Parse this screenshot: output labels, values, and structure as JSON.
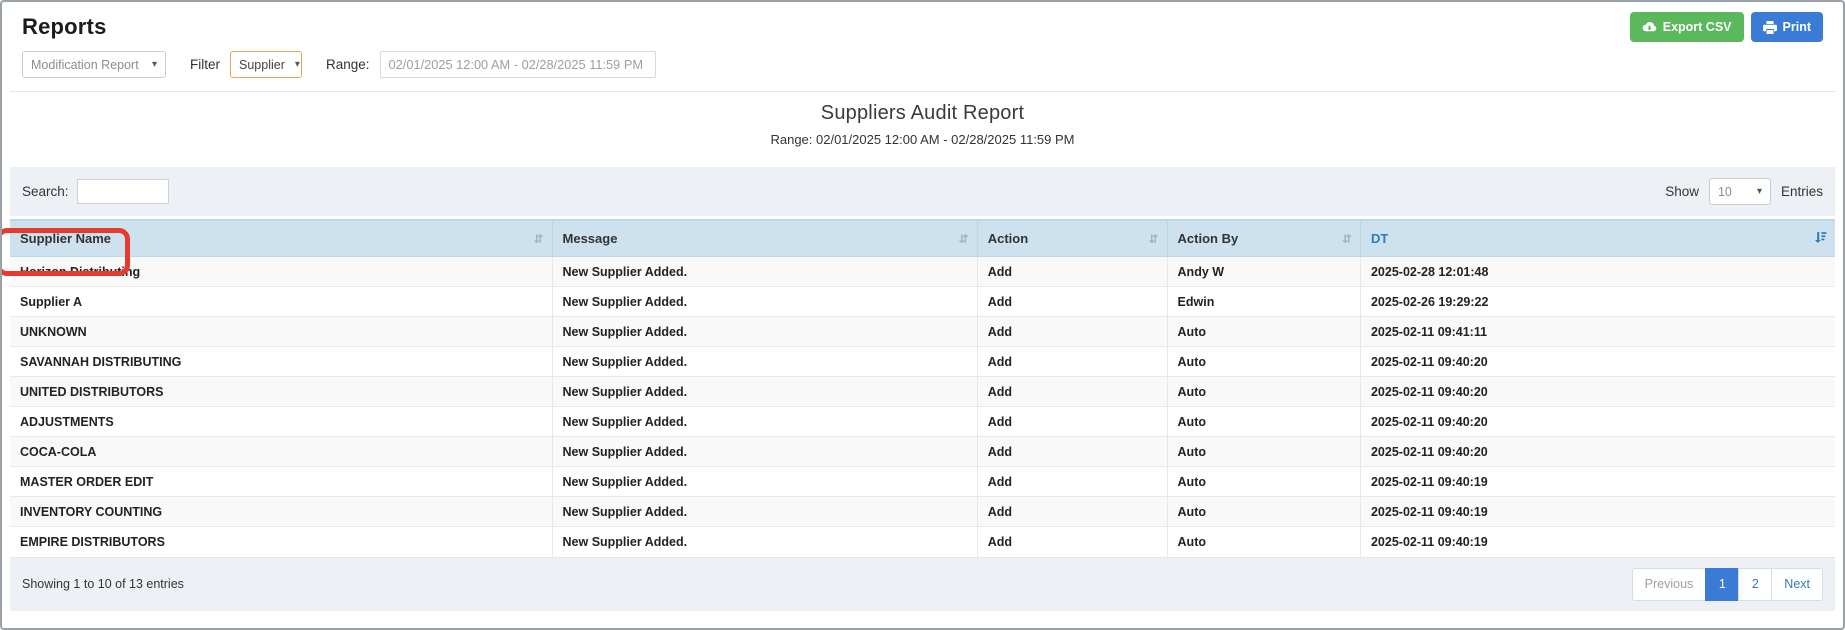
{
  "page": {
    "title": "Reports"
  },
  "controls": {
    "report_type_select": {
      "value": "Modification Report"
    },
    "filter_label": "Filter",
    "filter_select": {
      "value": "Supplier"
    },
    "range_label": "Range:",
    "range_value": "02/01/2025 12:00 AM - 02/28/2025 11:59 PM",
    "export_csv_label": "Export CSV",
    "print_label": "Print"
  },
  "report": {
    "title": "Suppliers Audit Report",
    "subtitle": "Range: 02/01/2025 12:00 AM - 02/28/2025 11:59 PM"
  },
  "table_controls": {
    "search_label": "Search:",
    "search_value": "",
    "show_label": "Show",
    "page_size": "10",
    "entries_label": "Entries"
  },
  "table": {
    "columns": [
      {
        "label": "Supplier Name",
        "sort": "inactive"
      },
      {
        "label": "Message",
        "sort": "inactive"
      },
      {
        "label": "Action",
        "sort": "inactive"
      },
      {
        "label": "Action By",
        "sort": "inactive"
      },
      {
        "label": "DT",
        "sort": "desc-active"
      }
    ],
    "rows": [
      {
        "supplier": "Horizon Distributing",
        "message": "New Supplier Added.",
        "action": "Add",
        "action_by": "Andy W",
        "dt": "2025-02-28 12:01:48"
      },
      {
        "supplier": "Supplier A",
        "message": "New Supplier Added.",
        "action": "Add",
        "action_by": "Edwin",
        "dt": "2025-02-26 19:29:22"
      },
      {
        "supplier": "UNKNOWN",
        "message": "New Supplier Added.",
        "action": "Add",
        "action_by": "Auto",
        "dt": "2025-02-11 09:41:11"
      },
      {
        "supplier": "SAVANNAH DISTRIBUTING",
        "message": "New Supplier Added.",
        "action": "Add",
        "action_by": "Auto",
        "dt": "2025-02-11 09:40:20"
      },
      {
        "supplier": "UNITED DISTRIBUTORS",
        "message": "New Supplier Added.",
        "action": "Add",
        "action_by": "Auto",
        "dt": "2025-02-11 09:40:20"
      },
      {
        "supplier": "ADJUSTMENTS",
        "message": "New Supplier Added.",
        "action": "Add",
        "action_by": "Auto",
        "dt": "2025-02-11 09:40:20"
      },
      {
        "supplier": "COCA-COLA",
        "message": "New Supplier Added.",
        "action": "Add",
        "action_by": "Auto",
        "dt": "2025-02-11 09:40:20"
      },
      {
        "supplier": "MASTER ORDER EDIT",
        "message": "New Supplier Added.",
        "action": "Add",
        "action_by": "Auto",
        "dt": "2025-02-11 09:40:19"
      },
      {
        "supplier": "INVENTORY COUNTING",
        "message": "New Supplier Added.",
        "action": "Add",
        "action_by": "Auto",
        "dt": "2025-02-11 09:40:19"
      },
      {
        "supplier": "EMPIRE DISTRIBUTORS",
        "message": "New Supplier Added.",
        "action": "Add",
        "action_by": "Auto",
        "dt": "2025-02-11 09:40:19"
      }
    ]
  },
  "footer": {
    "summary": "Showing 1 to 10 of 13 entries",
    "pagination": {
      "previous": "Previous",
      "pages": [
        "1",
        "2"
      ],
      "active_page": "1",
      "next": "Next"
    }
  },
  "annotation": {
    "highlight_target": "supplier-name-header",
    "color": "#e8392f"
  },
  "colors": {
    "header_bg": "#cde2ee",
    "toolbar_bg": "#edf1f6",
    "export_green": "#5cb85c",
    "print_blue": "#3a7bd5",
    "link_blue": "#337ab7",
    "annotation_red": "#e8392f"
  }
}
